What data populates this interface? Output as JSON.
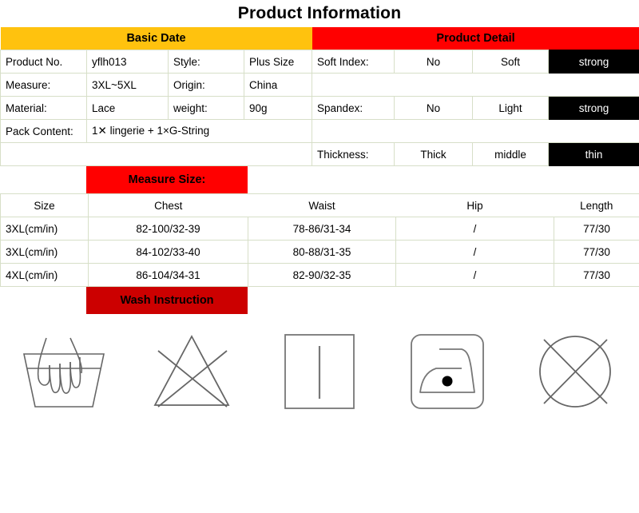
{
  "title": "Product Information",
  "sections": {
    "basic_header": "Basic Date",
    "detail_header": "Product Detail",
    "measure_banner": "Measure Size:",
    "wash_banner": "Wash Instruction"
  },
  "colors": {
    "basic_header_bg": "#ffc20e",
    "detail_header_bg": "#ff0000",
    "measure_banner_bg": "#ff0000",
    "wash_banner_bg": "#cc0000",
    "selected_cell_bg": "#000000",
    "selected_cell_fg": "#ffffff",
    "grid_border": "#d7dfc8"
  },
  "basic_data": {
    "rows": [
      {
        "label": "Product No.",
        "value": "yflh013",
        "label2": "Style:",
        "value2": "Plus Size"
      },
      {
        "label": "Measure:",
        "value": "3XL~5XL",
        "label2": "Origin:",
        "value2": "China"
      },
      {
        "label": "Material:",
        "value": "Lace",
        "label2": "weight:",
        "value2": "90g"
      }
    ],
    "pack_label": "Pack Content:",
    "pack_value": "1✕ lingerie + 1×G-String"
  },
  "product_detail": {
    "rows": [
      {
        "label": "Soft Index:",
        "options": [
          "No",
          "Soft",
          "strong"
        ],
        "selected": 2
      },
      {
        "label": "Spandex:",
        "options": [
          "No",
          "Light",
          "strong"
        ],
        "selected": 2
      },
      {
        "label": "Thickness:",
        "options": [
          "Thick",
          "middle",
          "thin"
        ],
        "selected": 2
      }
    ]
  },
  "measure_size": {
    "columns": [
      "Size",
      "Chest",
      "Waist",
      "Hip",
      "Length"
    ],
    "rows": [
      [
        "3XL(cm/in)",
        "82-100/32-39",
        "78-86/31-34",
        "/",
        "77/30"
      ],
      [
        "3XL(cm/in)",
        "84-102/33-40",
        "80-88/31-35",
        "/",
        "77/30"
      ],
      [
        "4XL(cm/in)",
        "86-104/34-31",
        "82-90/32-35",
        "/",
        "77/30"
      ]
    ]
  },
  "wash_icons": [
    {
      "name": "hand-wash-icon",
      "label": "Hand wash"
    },
    {
      "name": "do-not-bleach-icon",
      "label": "Do not bleach"
    },
    {
      "name": "drip-dry-icon",
      "label": "Drip dry"
    },
    {
      "name": "iron-low-heat-icon",
      "label": "Iron low heat"
    },
    {
      "name": "do-not-dry-clean-icon",
      "label": "Do not dry clean"
    }
  ]
}
